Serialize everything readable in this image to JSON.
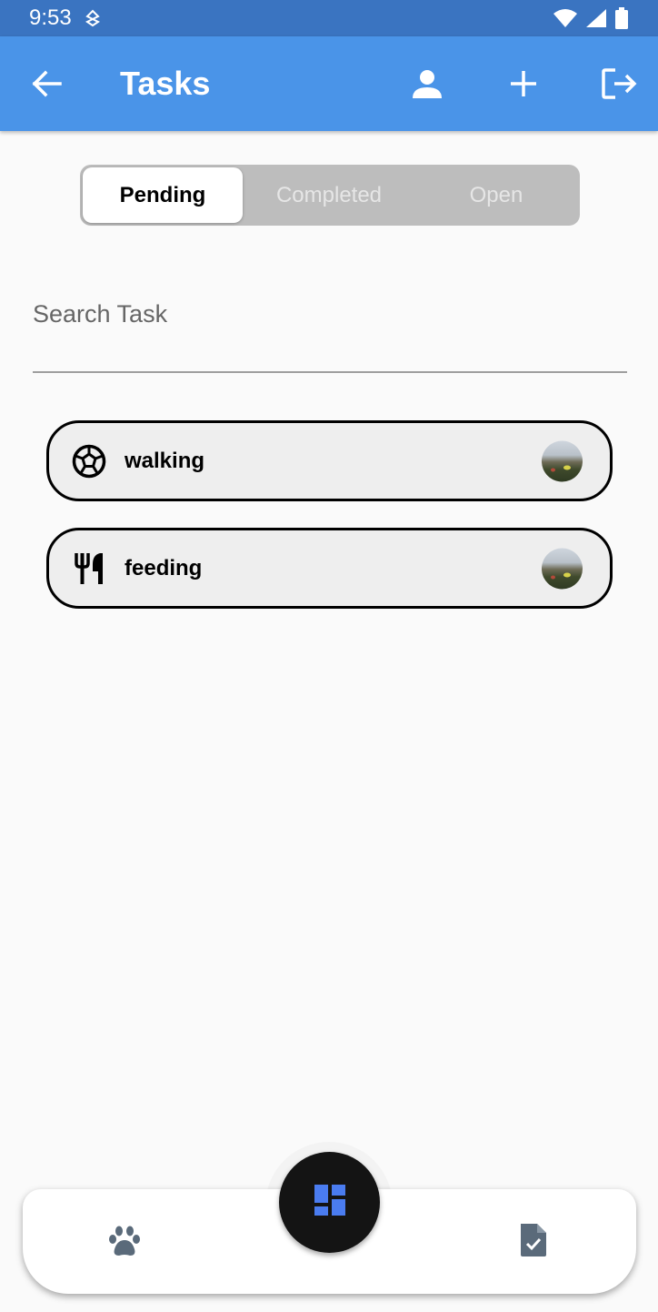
{
  "status_bar": {
    "time": "9:53",
    "icons": [
      "data-saver-icon",
      "wifi-icon",
      "signal-icon",
      "battery-icon"
    ]
  },
  "app_bar": {
    "title": "Tasks",
    "icons": [
      "back-arrow-icon",
      "person-icon",
      "plus-icon",
      "logout-icon"
    ],
    "color": "#4a94e8"
  },
  "segmented": {
    "tabs": [
      {
        "label": "Pending",
        "selected": true
      },
      {
        "label": "Completed",
        "selected": false
      },
      {
        "label": "Open",
        "selected": false
      }
    ]
  },
  "search": {
    "placeholder": "Search Task",
    "value": ""
  },
  "tasks": [
    {
      "name": "walking",
      "icon": "soccer-ball-icon"
    },
    {
      "name": "feeding",
      "icon": "restaurant-icon"
    }
  ],
  "bottom_nav": {
    "items": [
      "paw-icon",
      "dashboard-icon",
      "task-document-icon"
    ],
    "fab_icon_color": "#4a7cf0"
  }
}
